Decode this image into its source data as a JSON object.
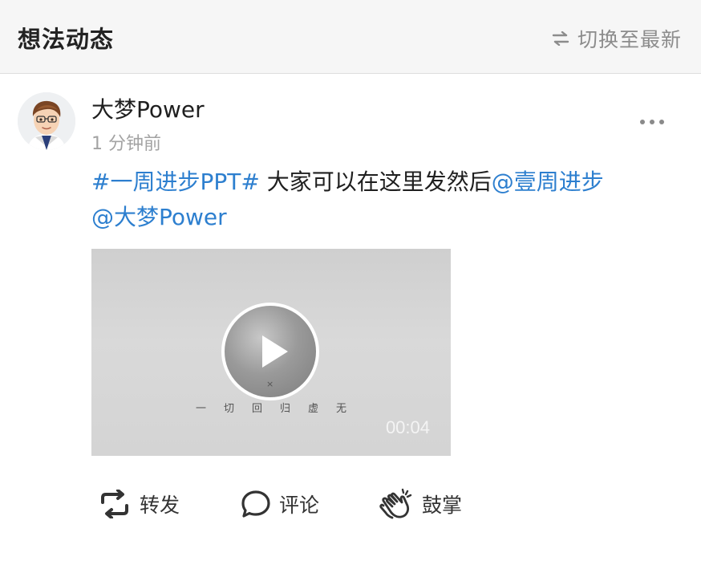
{
  "header": {
    "title": "想法动态",
    "switch_label": "切换至最新",
    "switch_icon": "swap-arrows-icon"
  },
  "post": {
    "author": "大梦Power",
    "time": "1 分钟前",
    "content": {
      "topic": "#一周进步PPT#",
      "text": " 大家可以在这里发然后",
      "mention_1": "@壹周进步",
      "mention_2": "@大梦Power"
    },
    "video": {
      "x_mark": "×",
      "caption": "一切回归虚无",
      "duration": "00:04"
    },
    "actions": {
      "repost_label": "转发",
      "comment_label": "评论",
      "clap_label": "鼓掌"
    }
  },
  "colors": {
    "link": "#2d7fcf",
    "header_bg": "#f6f6f6",
    "muted": "#a3a3a3"
  }
}
